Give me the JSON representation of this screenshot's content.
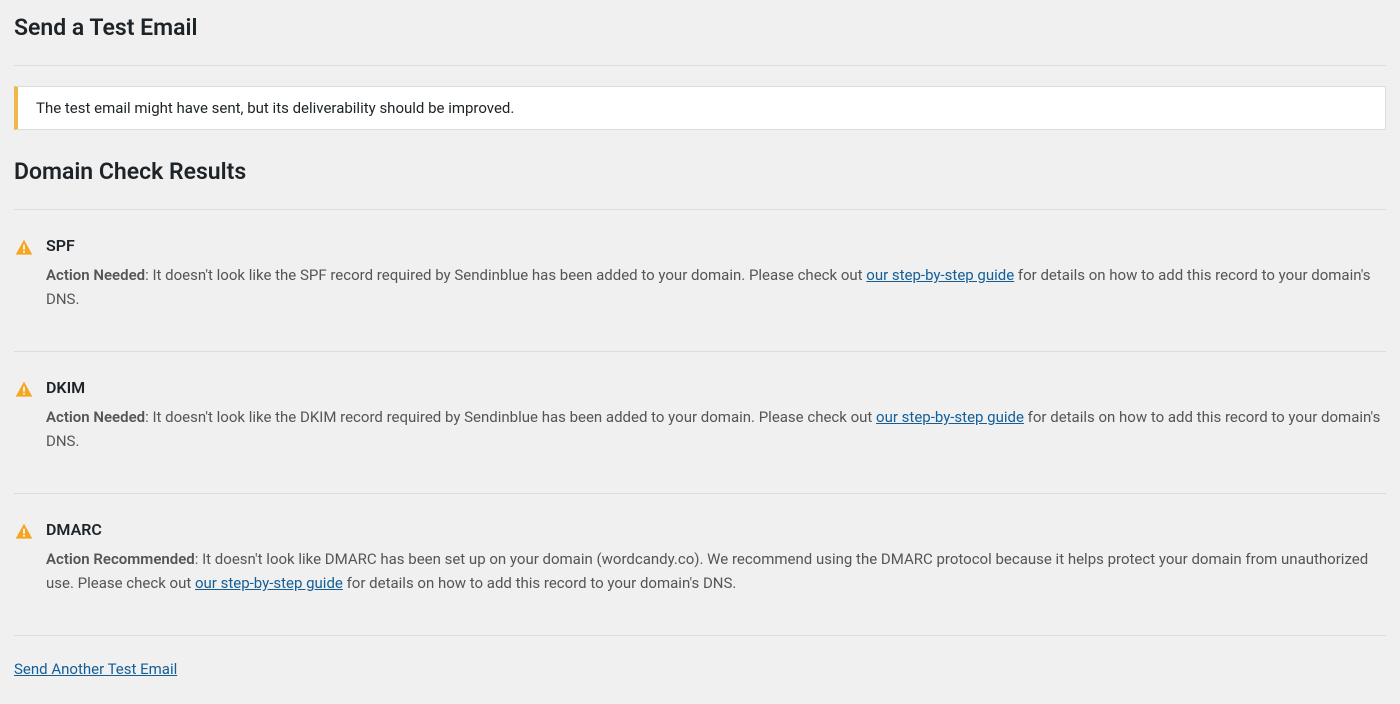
{
  "header": {
    "title": "Send a Test Email"
  },
  "notice": {
    "message": "The test email might have sent, but its deliverability should be improved."
  },
  "results": {
    "title": "Domain Check Results",
    "items": [
      {
        "name": "SPF",
        "action_label": "Action Needed",
        "desc_before": ": It doesn't look like the SPF record required by Sendinblue has been added to your domain. Please check out ",
        "link_text": "our step-by-step guide",
        "desc_after": " for details on how to add this record to your domain's DNS."
      },
      {
        "name": "DKIM",
        "action_label": "Action Needed",
        "desc_before": ": It doesn't look like the DKIM record required by Sendinblue has been added to your domain. Please check out ",
        "link_text": "our step-by-step guide",
        "desc_after": " for details on how to add this record to your domain's DNS."
      },
      {
        "name": "DMARC",
        "action_label": "Action Recommended",
        "desc_before": ": It doesn't look like DMARC has been set up on your domain (wordcandy.co). We recommend using the DMARC protocol because it helps protect your domain from unauthorized use. Please check out ",
        "link_text": "our step-by-step guide",
        "desc_after": " for details on how to add this record to your domain's DNS."
      }
    ]
  },
  "footer": {
    "link_label": "Send Another Test Email"
  }
}
